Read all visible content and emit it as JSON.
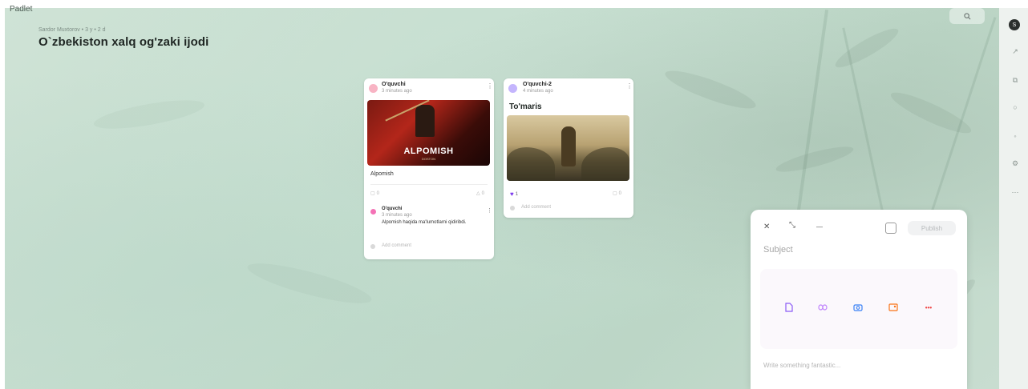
{
  "brand": "Padlet",
  "board": {
    "breadcrumb": "Sardor Muxtorov • 3 y • 2 d",
    "title": "O`zbekiston xalq og'zaki ijodi"
  },
  "search": {
    "icon": "search-icon"
  },
  "rail": {
    "avatar_initial": "S",
    "icons": [
      "share-icon",
      "remake-icon",
      "comment-icon",
      "bell-icon",
      "settings-icon",
      "more-icon"
    ]
  },
  "posts": [
    {
      "author": "O'quvchi",
      "time": "3 minutes ago",
      "menu": "⋮",
      "image_caption": "ALPOMISH",
      "image_subcaption": "DOSTON",
      "body": "Alpomish",
      "comment_count": "0",
      "like_count": "0",
      "comments": [
        {
          "author": "O'quvchi",
          "time": "3 minutes ago",
          "text": "Alpomish haqida ma'lumotlarni qidiribdi."
        }
      ],
      "add_comment": "Add comment"
    },
    {
      "author": "O'quvchi-2",
      "time": "4 minutes ago",
      "menu": "⋮",
      "subject": "To'maris",
      "reaction_count": "1",
      "comment_count": "0",
      "add_comment": "Add comment"
    }
  ],
  "composer": {
    "close": "✕",
    "expand": "⤡",
    "minimize": "—",
    "publish": "Publish",
    "subject_placeholder": "Subject",
    "body_placeholder": "Write something fantastic...",
    "attachments": [
      "file-icon",
      "link-icon",
      "camera-icon",
      "image-search-icon",
      "more-attachments-icon"
    ],
    "attachment_colors": [
      "#8b5cf6",
      "#c084fc",
      "#3b82f6",
      "#f97316",
      "#ef4444"
    ]
  }
}
